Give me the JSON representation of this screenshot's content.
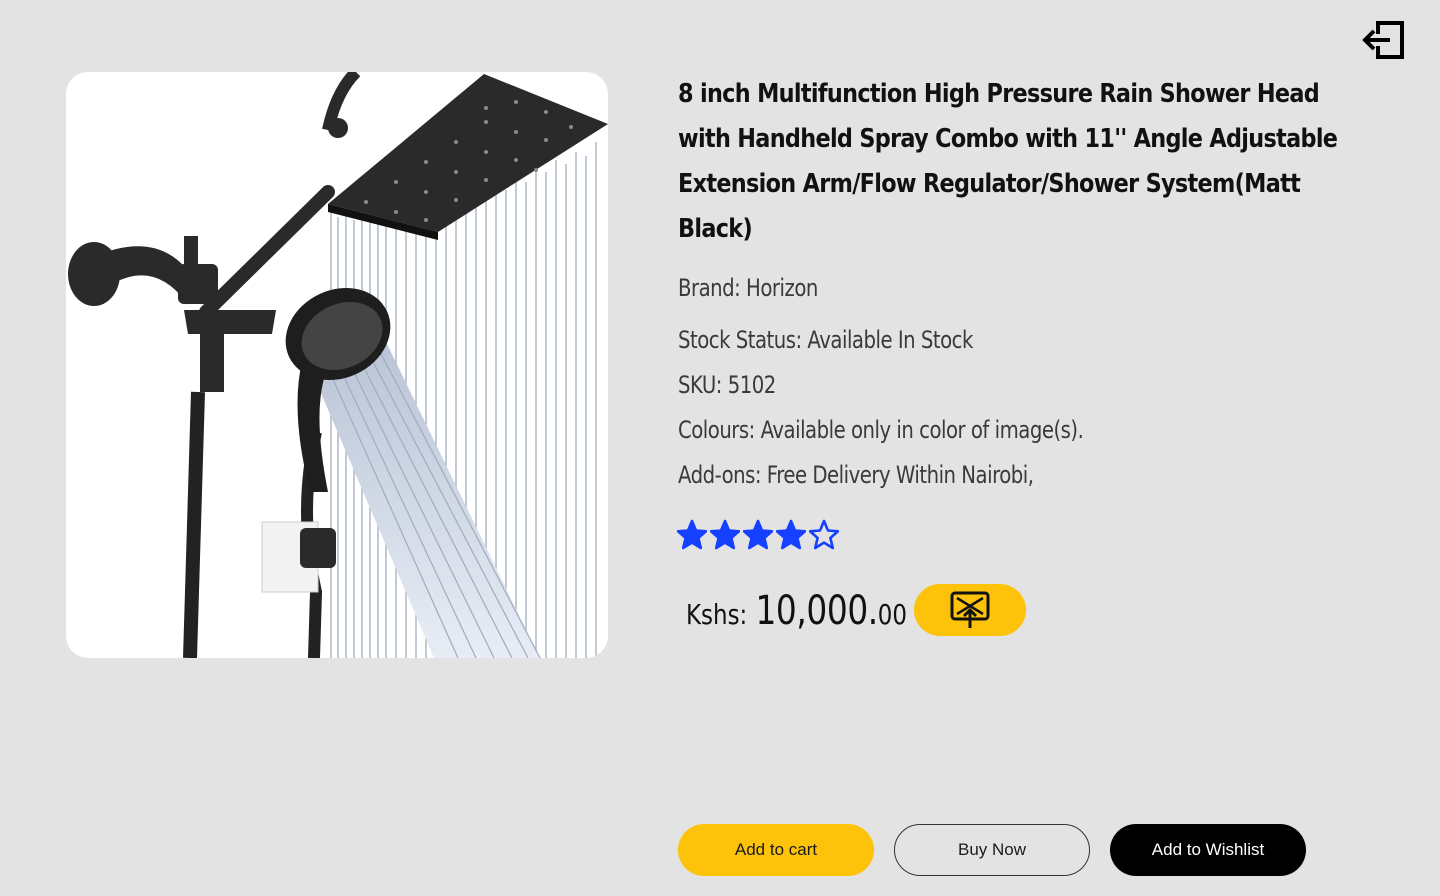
{
  "header": {
    "exit_icon": "exit-left-icon"
  },
  "product": {
    "title": "8 inch Multifunction High Pressure Rain Shower Head with Handheld Spray Combo with 11'' Angle Adjustable Extension Arm/Flow Regulator/Shower System(Matt Black)",
    "brand": "Brand:  Horizon",
    "stock_status": "Stock Status: Available In Stock",
    "sku": "SKU: 5102",
    "colours": "Colours: Available only in color of image(s).",
    "addons": "Add-ons: Free Delivery Within Nairobi,",
    "rating": {
      "value": 4,
      "max": 5,
      "color": "#1640ff"
    },
    "price": {
      "currency": "Kshs:",
      "amount": "10,000.",
      "cents": "00"
    },
    "image": "shower-head-product-image"
  },
  "ar_button": {
    "icon": "ar-view-icon",
    "color": "#fcc30a"
  },
  "actions": {
    "add_to_cart": "Add to cart",
    "buy_now": "Buy Now",
    "add_to_wishlist": "Add to Wishlist"
  },
  "colors": {
    "background": "#e3e3e3",
    "accent": "#fcc30a",
    "dark": "#000000"
  }
}
